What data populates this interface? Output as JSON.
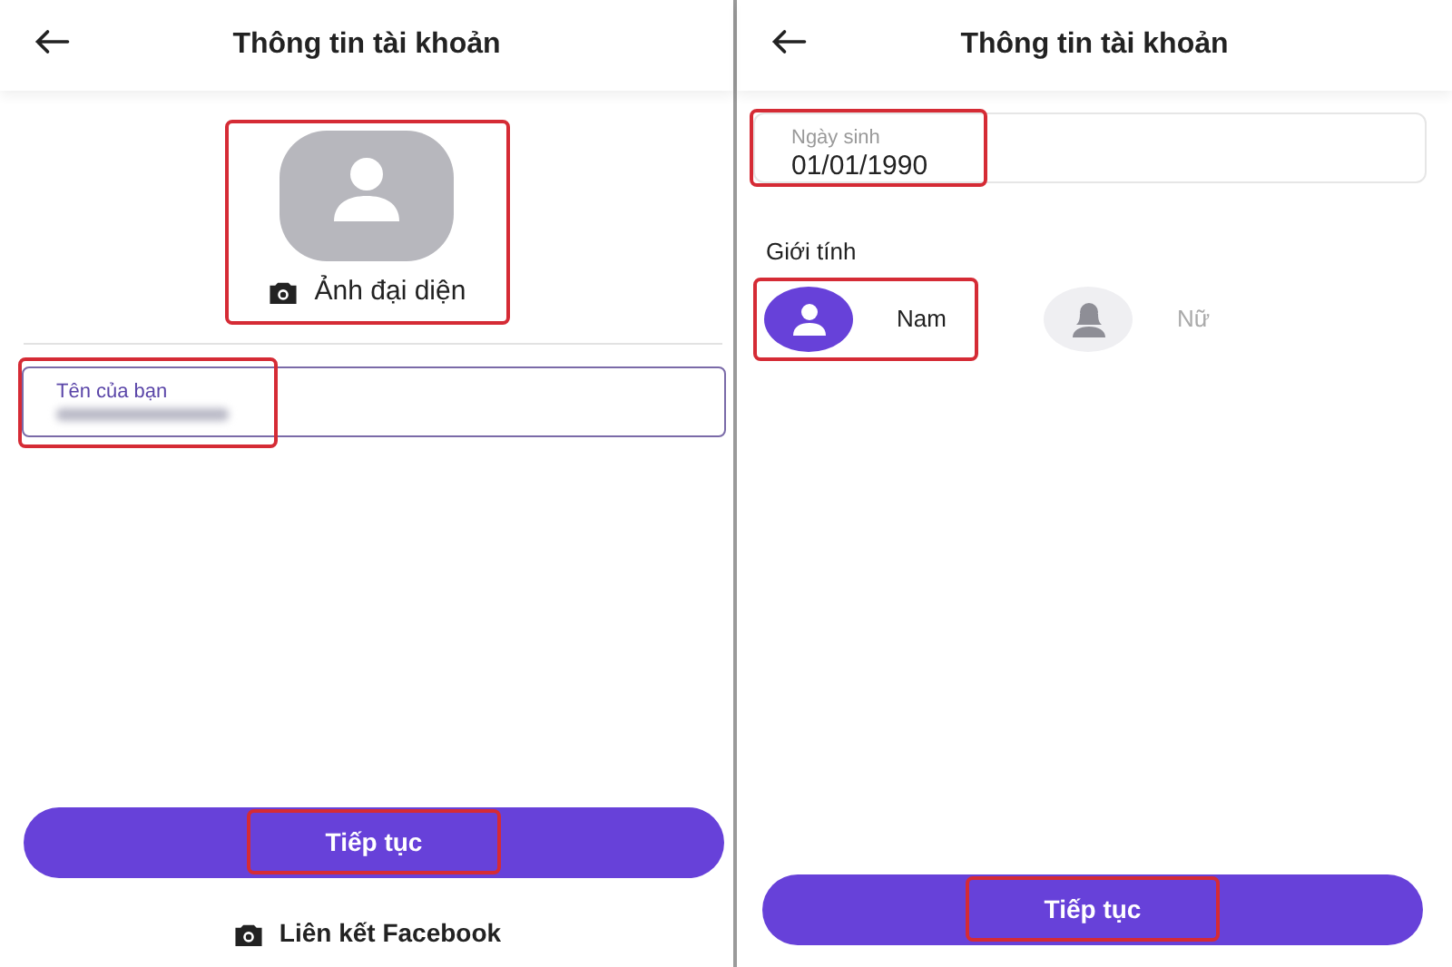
{
  "screens": [
    {
      "title": "Thông tin tài khoản",
      "avatar": {
        "label": "Ảnh đại diện",
        "highlighted": true
      },
      "name_field": {
        "label": "Tên của bạn",
        "value_obscured": true,
        "highlighted": true
      },
      "continue_button": {
        "label": "Tiếp tục",
        "highlighted": true
      },
      "facebook_link": {
        "label": "Liên kết Facebook"
      }
    },
    {
      "title": "Thông tin tài khoản",
      "birthday_field": {
        "label": "Ngày sinh",
        "value": "01/01/1990",
        "highlighted": true
      },
      "gender": {
        "label": "Giới tính",
        "options": [
          {
            "label": "Nam",
            "kind": "male",
            "selected": true,
            "highlighted": true
          },
          {
            "label": "Nữ",
            "kind": "female",
            "selected": false,
            "highlighted": false
          }
        ]
      },
      "continue_button": {
        "label": "Tiếp tục",
        "highlighted": true
      }
    }
  ]
}
